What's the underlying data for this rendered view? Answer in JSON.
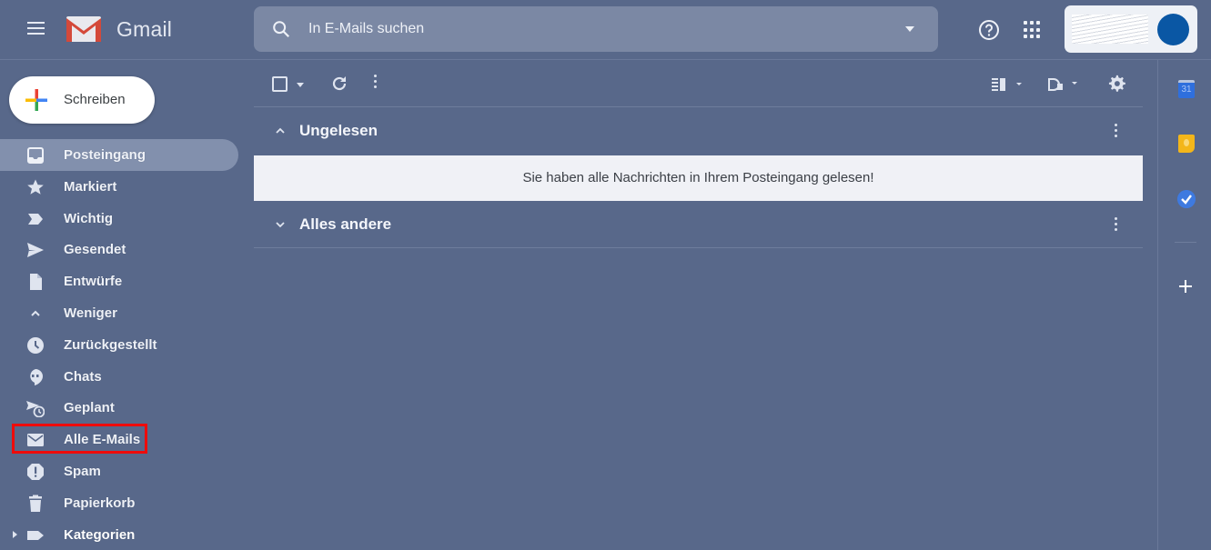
{
  "app": {
    "title": "Gmail"
  },
  "header": {
    "search_placeholder": "In E-Mails suchen",
    "icons": [
      "menu-icon",
      "gmail-logo-icon",
      "search-icon",
      "search-options-icon",
      "help-icon",
      "apps-grid-icon",
      "avatar"
    ]
  },
  "sidebar": {
    "compose_label": "Schreiben",
    "items": [
      {
        "label": "Posteingang",
        "icon": "inbox-icon",
        "active": true
      },
      {
        "label": "Markiert",
        "icon": "star-icon"
      },
      {
        "label": "Wichtig",
        "icon": "important-icon"
      },
      {
        "label": "Gesendet",
        "icon": "send-icon"
      },
      {
        "label": "Entwürfe",
        "icon": "draft-icon"
      },
      {
        "label": "Weniger",
        "icon": "chevron-up-icon"
      },
      {
        "label": "Zurückgestellt",
        "icon": "clock-icon"
      },
      {
        "label": "Chats",
        "icon": "chat-icon"
      },
      {
        "label": "Geplant",
        "icon": "scheduled-send-icon"
      },
      {
        "label": "Alle E-Mails",
        "icon": "mail-icon",
        "highlighted": true
      },
      {
        "label": "Spam",
        "icon": "spam-icon"
      },
      {
        "label": "Papierkorb",
        "icon": "trash-icon"
      },
      {
        "label": "Kategorien",
        "icon": "label-icon",
        "bold": true
      }
    ],
    "highlight_color": "#ee0b0b"
  },
  "main": {
    "sections": [
      {
        "title": "Ungelesen",
        "expanded": true,
        "empty_message": "Sie haben alle Nachrichten in Ihrem Posteingang gelesen!"
      },
      {
        "title": "Alles andere",
        "expanded": false
      }
    ]
  },
  "right_rail": {
    "apps": [
      {
        "name": "calendar",
        "badge": "31"
      },
      {
        "name": "keep"
      },
      {
        "name": "tasks"
      }
    ]
  },
  "colors": {
    "background": "#58688a",
    "active_nav": "#8290ad",
    "search_bg": "#7b88a4",
    "avatar": "#0a57a4"
  }
}
